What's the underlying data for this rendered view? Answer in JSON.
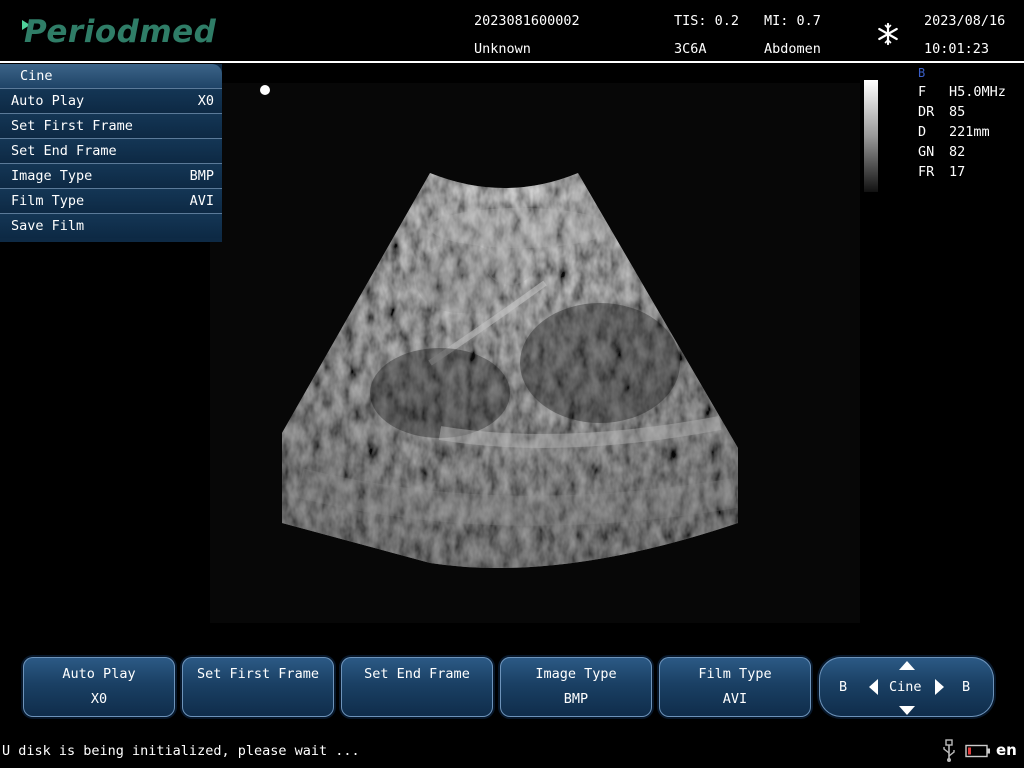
{
  "header": {
    "logo": "Periodmed",
    "patient_id": "2023081600002",
    "patient_name": "Unknown",
    "tis": "TIS: 0.2",
    "mi": "MI: 0.7",
    "probe": "3C6A",
    "exam": "Abdomen",
    "date": "2023/08/16",
    "time": "10:01:23",
    "freeze_icon": "snowflake-icon"
  },
  "side_menu": {
    "title": "Cine",
    "items": [
      {
        "label": "Auto Play",
        "value": "X0"
      },
      {
        "label": "Set First Frame",
        "value": ""
      },
      {
        "label": "Set End Frame",
        "value": ""
      },
      {
        "label": "Image Type",
        "value": "BMP"
      },
      {
        "label": "Film Type",
        "value": "AVI"
      },
      {
        "label": "Save Film",
        "value": ""
      }
    ]
  },
  "params": {
    "mode": "B",
    "rows": [
      {
        "key": "F",
        "value": "H5.0MHz"
      },
      {
        "key": "DR",
        "value": "85"
      },
      {
        "key": "D",
        "value": "221mm"
      },
      {
        "key": "GN",
        "value": "82"
      },
      {
        "key": "FR",
        "value": "17"
      }
    ]
  },
  "bottom_buttons": [
    {
      "label": "Auto Play",
      "value": "X0"
    },
    {
      "label": "Set First Frame",
      "value": ""
    },
    {
      "label": "Set End Frame",
      "value": ""
    },
    {
      "label": "Image Type",
      "value": "BMP"
    },
    {
      "label": "Film Type",
      "value": "AVI"
    }
  ],
  "nav": {
    "center": "Cine",
    "left": "B",
    "right": "B"
  },
  "status": {
    "message": "U disk is being initialized, please wait ...",
    "language": "en"
  },
  "colors": {
    "accent": "#1a4064",
    "logo": "#2f7d67",
    "mode_indicator": "#3a5fc8"
  }
}
